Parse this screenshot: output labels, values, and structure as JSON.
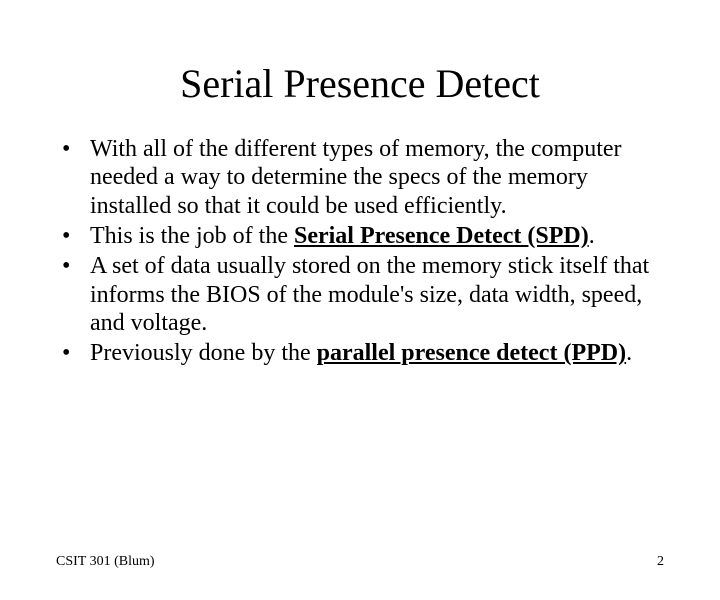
{
  "title": "Serial Presence Detect",
  "bullets": [
    {
      "pre": "With all of the different types of memory, the computer needed a way to determine the specs of the memory installed so that it could be used efficiently."
    },
    {
      "pre": "This is the job of the ",
      "emph": "Serial Presence Detect (SPD)",
      "post": "."
    },
    {
      "pre": "A set of data usually stored on the memory stick itself that informs the BIOS of the module's size, data width, speed, and voltage."
    },
    {
      "pre": "Previously done by the ",
      "emph": "parallel presence detect (PPD)",
      "post": "."
    }
  ],
  "footer": {
    "left": "CSIT 301 (Blum)",
    "right": "2"
  }
}
